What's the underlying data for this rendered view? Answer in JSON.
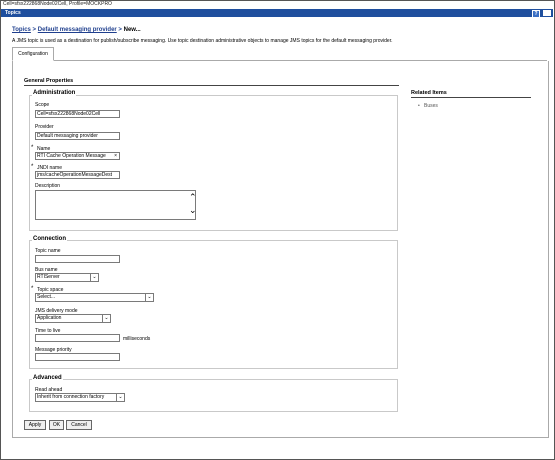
{
  "window": {
    "title": "Cell=sfsx222868Node02Cell, Profile=MOCKPRO"
  },
  "header": {
    "title": "Topics",
    "help_glyph": "?"
  },
  "breadcrumb": {
    "item1": "Topics",
    "sep1": " > ",
    "item2": "Default messaging provider",
    "sep2": " > ",
    "current": "New..."
  },
  "description": "A JMS topic is used as a destination for publish/subscribe messaging. Use topic destination administrative objects to manage JMS topics for the default messaging provider.",
  "tabs": {
    "configuration": "Configuration"
  },
  "general_properties": "General Properties",
  "administration": {
    "title": "Administration",
    "scope_label": "Scope",
    "scope_value": "Cell=sfsx222868Node02Cell",
    "provider_label": "Provider",
    "provider_value": "Default messaging provider",
    "required_mark": "*",
    "name_label": "Name",
    "name_value": "RTI Cache Operation Message",
    "clear_glyph": "×",
    "jndi_label": "JNDI name",
    "jndi_value": "jms/cacheOperationMessageDest",
    "description_label": "Description",
    "scroll_up": "⌃",
    "scroll_down": "⌄"
  },
  "connection": {
    "title": "Connection",
    "topic_name_label": "Topic name",
    "topic_name_value": "",
    "bus_name_label": "Bus name",
    "bus_name_value": "RTIServer",
    "required_mark": "*",
    "topic_space_label": "Topic space",
    "topic_space_value": "Select...",
    "delivery_label": "JMS delivery mode",
    "delivery_value": "Application",
    "ttl_label": "Time to live",
    "ttl_value": "",
    "ttl_unit": "milliseconds",
    "priority_label": "Message priority",
    "priority_value": ""
  },
  "advanced": {
    "title": "Advanced",
    "read_ahead_label": "Read ahead",
    "read_ahead_value": "Inherit from connection factory"
  },
  "dropdown_glyph": "⌄",
  "related": {
    "title": "Related Items",
    "bullet": "•",
    "items": [
      "Buses"
    ]
  },
  "buttons": {
    "apply": "Apply",
    "ok": "OK",
    "cancel": "Cancel"
  }
}
